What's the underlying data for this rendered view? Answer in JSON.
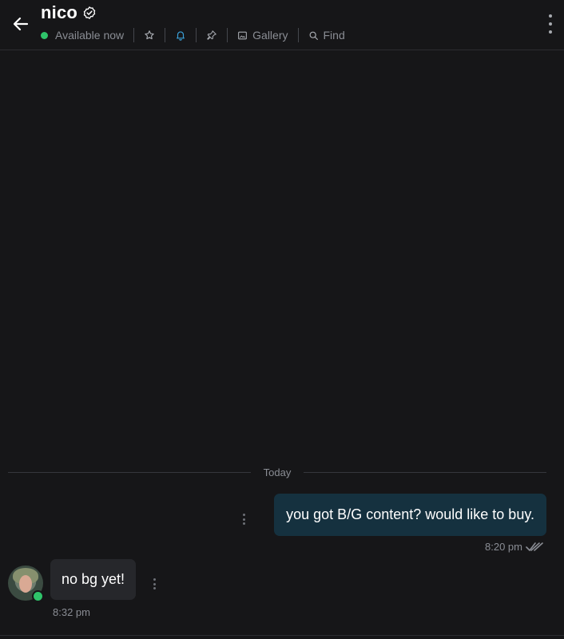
{
  "header": {
    "title": "nico",
    "status": "Available now",
    "gallery_label": "Gallery",
    "find_label": "Find"
  },
  "colors": {
    "background": "#161618",
    "online": "#2fc46a",
    "notification_accent": "#3aa0d8",
    "outgoing_bubble": "#15313f",
    "incoming_bubble": "#26272b"
  },
  "icons": {
    "back": "arrow-left-icon",
    "verified": "verified-badge-icon",
    "favorite": "star-icon",
    "notifications": "bell-icon",
    "pin": "pin-icon",
    "gallery": "image-icon",
    "find": "search-icon",
    "menu": "more-vertical-icon"
  },
  "chat": {
    "date_divider": "Today",
    "messages": [
      {
        "direction": "outgoing",
        "text": "you got B/G content? would like to buy.",
        "time": "8:20 pm",
        "read": true
      },
      {
        "direction": "incoming",
        "text": "no bg yet!",
        "time": "8:32 pm"
      }
    ]
  }
}
